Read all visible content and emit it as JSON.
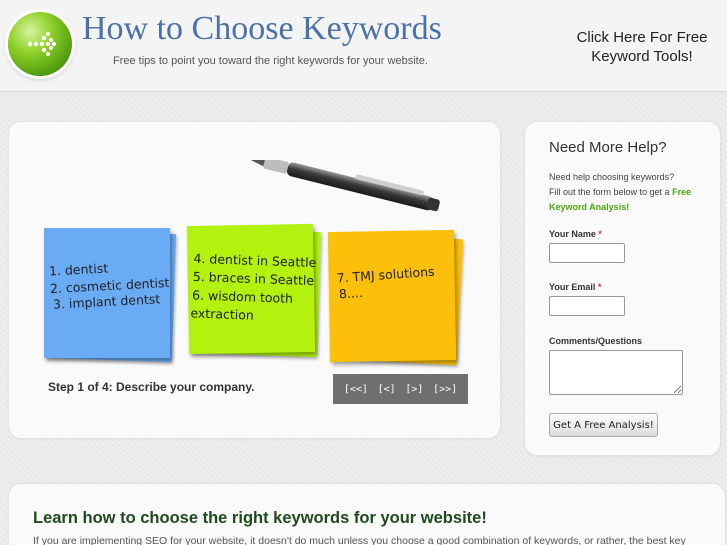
{
  "header": {
    "title": "How to Choose Keywords",
    "tagline": "Free tips to point you toward the right keywords for your website.",
    "cta_line1": "Click Here For Free",
    "cta_line2": "Keyword Tools!",
    "logo_icon": "arrow-right-dotted-icon"
  },
  "slider": {
    "notes": [
      {
        "color": "#6aabf5",
        "lines": [
          "1. dentist",
          "2. cosmetic dentist",
          "3. implant dentst"
        ]
      },
      {
        "color": "#b2f20e",
        "lines": [
          "4. dentist in Seattle",
          "5. braces in Seattle",
          "6. wisdom tooth",
          "extraction"
        ]
      },
      {
        "color": "#fdc00a",
        "lines": [
          "7. TMJ solutions",
          "8...."
        ]
      }
    ],
    "step_caption": "Step 1 of 4: Describe your company.",
    "nav": {
      "first": "[<<]",
      "prev": "[<]",
      "next": "[>]",
      "last": "[>>]"
    },
    "pen_icon": "pen-icon"
  },
  "help": {
    "title": "Need More Help?",
    "intro_line1": "Need help choosing keywords?",
    "intro_line2": "Fill out the form below to get a",
    "intro_highlight": "Free Keyword Analysis!",
    "name_label": "Your Name",
    "email_label": "Your Email",
    "comments_label": "Comments/Questions",
    "required_mark": "*",
    "submit_label": "Get A Free Analysis!",
    "name_value": "",
    "email_value": "",
    "comments_value": ""
  },
  "content": {
    "heading": "Learn how to choose the right keywords for your website!",
    "intro_text": "If you are implementing SEO for your website, it doesn't do much unless you choose a good combination of keywords, or rather, the best key"
  },
  "colors": {
    "title_blue": "#4a72a8",
    "highlight_green": "#4aa80d",
    "heading_green": "#1f4a1e"
  }
}
